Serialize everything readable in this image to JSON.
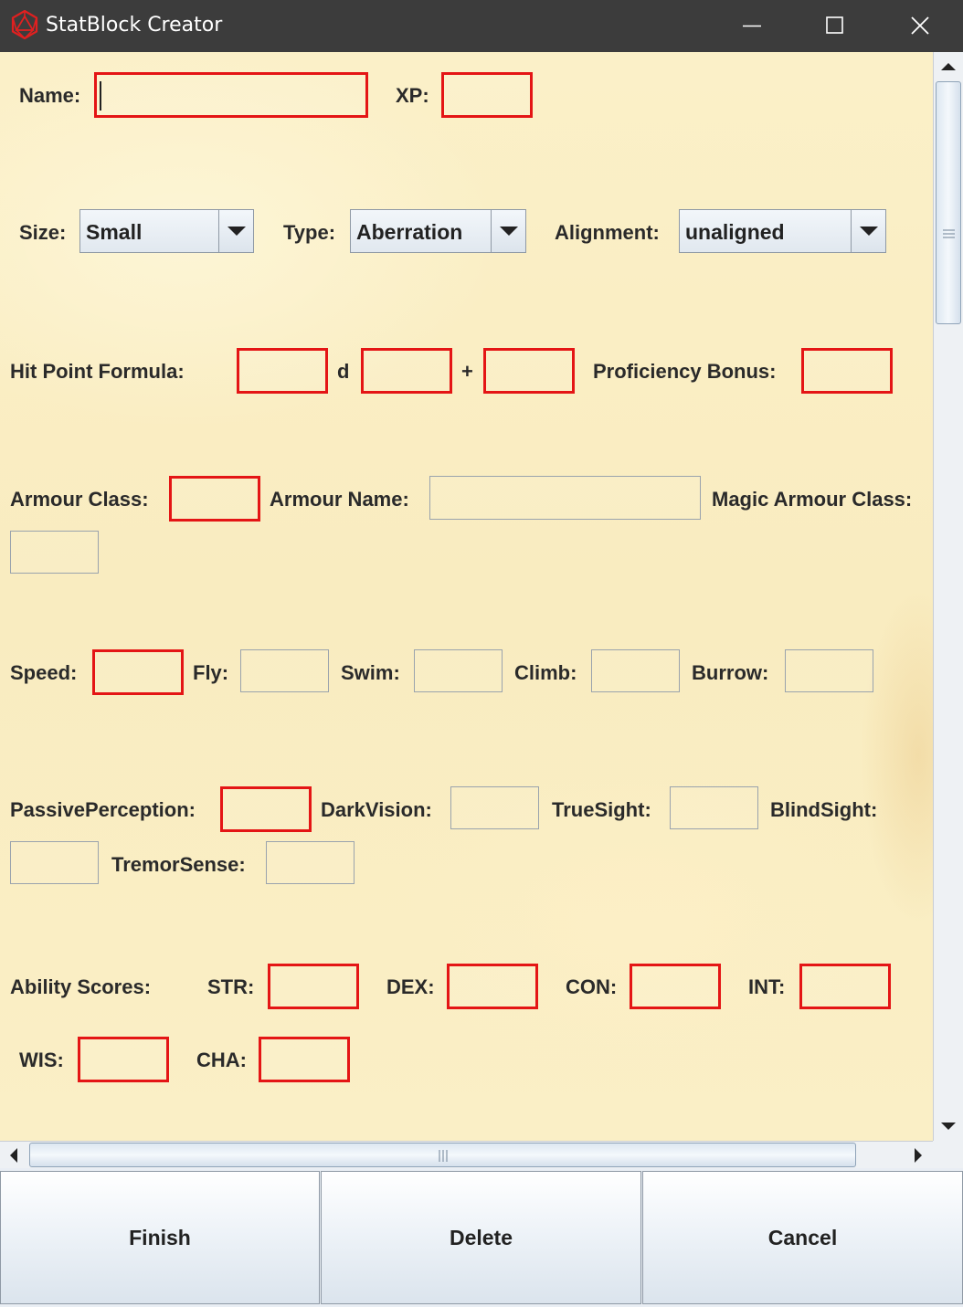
{
  "window": {
    "title": "StatBlock Creator",
    "icon": "d20-icon",
    "controls": [
      "minimize-icon",
      "maximize-icon",
      "close-icon"
    ]
  },
  "form": {
    "name": {
      "label": "Name:",
      "value": ""
    },
    "xp": {
      "label": "XP:",
      "value": ""
    },
    "size": {
      "label": "Size:",
      "value": "Small"
    },
    "type": {
      "label": "Type:",
      "value": "Aberration"
    },
    "alignment": {
      "label": "Alignment:",
      "value": "unaligned"
    },
    "hit_point_formula": {
      "label": "Hit Point Formula:",
      "dice_count": "",
      "d_label": "d",
      "dice_size": "",
      "plus_label": "+",
      "modifier": ""
    },
    "proficiency_bonus": {
      "label": "Proficiency Bonus:",
      "value": ""
    },
    "armour_class": {
      "label": "Armour Class:",
      "value": ""
    },
    "armour_name": {
      "label": "Armour Name:",
      "value": ""
    },
    "magic_armour_class": {
      "label": "Magic Armour Class:",
      "value": ""
    },
    "speed": {
      "label": "Speed:",
      "value": ""
    },
    "fly": {
      "label": "Fly:",
      "value": ""
    },
    "swim": {
      "label": "Swim:",
      "value": ""
    },
    "climb": {
      "label": "Climb:",
      "value": ""
    },
    "burrow": {
      "label": "Burrow:",
      "value": ""
    },
    "passive_perception": {
      "label": "PassivePerception:",
      "value": ""
    },
    "darkvision": {
      "label": "DarkVision:",
      "value": ""
    },
    "truesight": {
      "label": "TrueSight:",
      "value": ""
    },
    "blindsight": {
      "label": "BlindSight:",
      "value": ""
    },
    "tremorsense": {
      "label": "TremorSense:",
      "value": ""
    },
    "ability_scores": {
      "label": "Ability Scores:",
      "str": {
        "label": "STR:",
        "value": ""
      },
      "dex": {
        "label": "DEX:",
        "value": ""
      },
      "con": {
        "label": "CON:",
        "value": ""
      },
      "int": {
        "label": "INT:",
        "value": ""
      },
      "wis": {
        "label": "WIS:",
        "value": ""
      },
      "cha": {
        "label": "CHA:",
        "value": ""
      }
    }
  },
  "buttons": {
    "finish": "Finish",
    "delete": "Delete",
    "cancel": "Cancel"
  },
  "colors": {
    "required_border": "#e41515",
    "titlebar": "#3c3c3c",
    "parchment": "#faefc6"
  }
}
